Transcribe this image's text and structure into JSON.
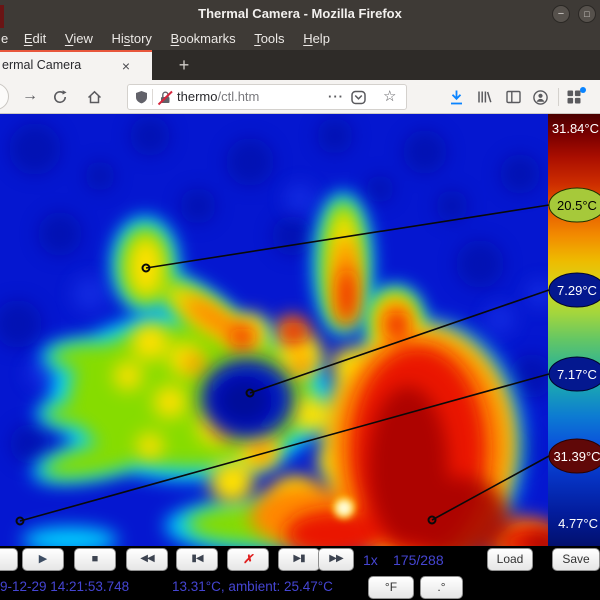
{
  "titlebar": {
    "title": "Thermal Camera - Mozilla Firefox",
    "minimize_glyph": "−",
    "maximize_glyph": "□"
  },
  "menubar": {
    "items": [
      {
        "pre": "e",
        "key": "",
        "post": ""
      },
      {
        "pre": "",
        "key": "E",
        "post": "dit"
      },
      {
        "pre": "",
        "key": "V",
        "post": "iew"
      },
      {
        "pre": "Hi",
        "key": "s",
        "post": "tory"
      },
      {
        "pre": "",
        "key": "B",
        "post": "ookmarks"
      },
      {
        "pre": "",
        "key": "T",
        "post": "ools"
      },
      {
        "pre": "",
        "key": "H",
        "post": "elp"
      }
    ]
  },
  "tabbar": {
    "tab_title": "ermal Camera",
    "close_glyph": "×",
    "new_tab_glyph": "+"
  },
  "navbar": {
    "forward_glyph": "→",
    "url_host": "thermo",
    "url_path": "/ctl.htm",
    "page_actions_glyph": "···",
    "star_glyph": "☆"
  },
  "scale": {
    "max_label": "31.84°C",
    "min_label": "4.77°C"
  },
  "callouts": [
    {
      "label": "20.5°C",
      "color": "#a6c93a",
      "text_color": "#000000"
    },
    {
      "label": "7.29°C",
      "color": "#04188f",
      "text_color": "#ffffff"
    },
    {
      "label": "7.17°C",
      "color": "#04188f",
      "text_color": "#ffffff"
    },
    {
      "label": "31.39°C",
      "color": "#600808",
      "text_color": "#ffffff"
    }
  ],
  "controls": {
    "record": "●",
    "play": "▶",
    "stop": "■",
    "rewind": "◀◀",
    "prev_frame": "▮◀",
    "delete": "✗",
    "next_frame": "▶▮",
    "fast_forward": "▶▶",
    "speed": "1x",
    "frame_counter": "175/288",
    "load": "Load",
    "save": "Save"
  },
  "statusbar": {
    "timestamp": "9-12-29 14:21:53.748",
    "reading": "13.31°C, ambient: 25.47°C",
    "fahrenheit_button": "°F",
    "precision_button": ".°"
  },
  "colors": {
    "accent_orange": "#e8563c",
    "link_blue": "#4545d2",
    "download_blue": "#0a84ff"
  }
}
